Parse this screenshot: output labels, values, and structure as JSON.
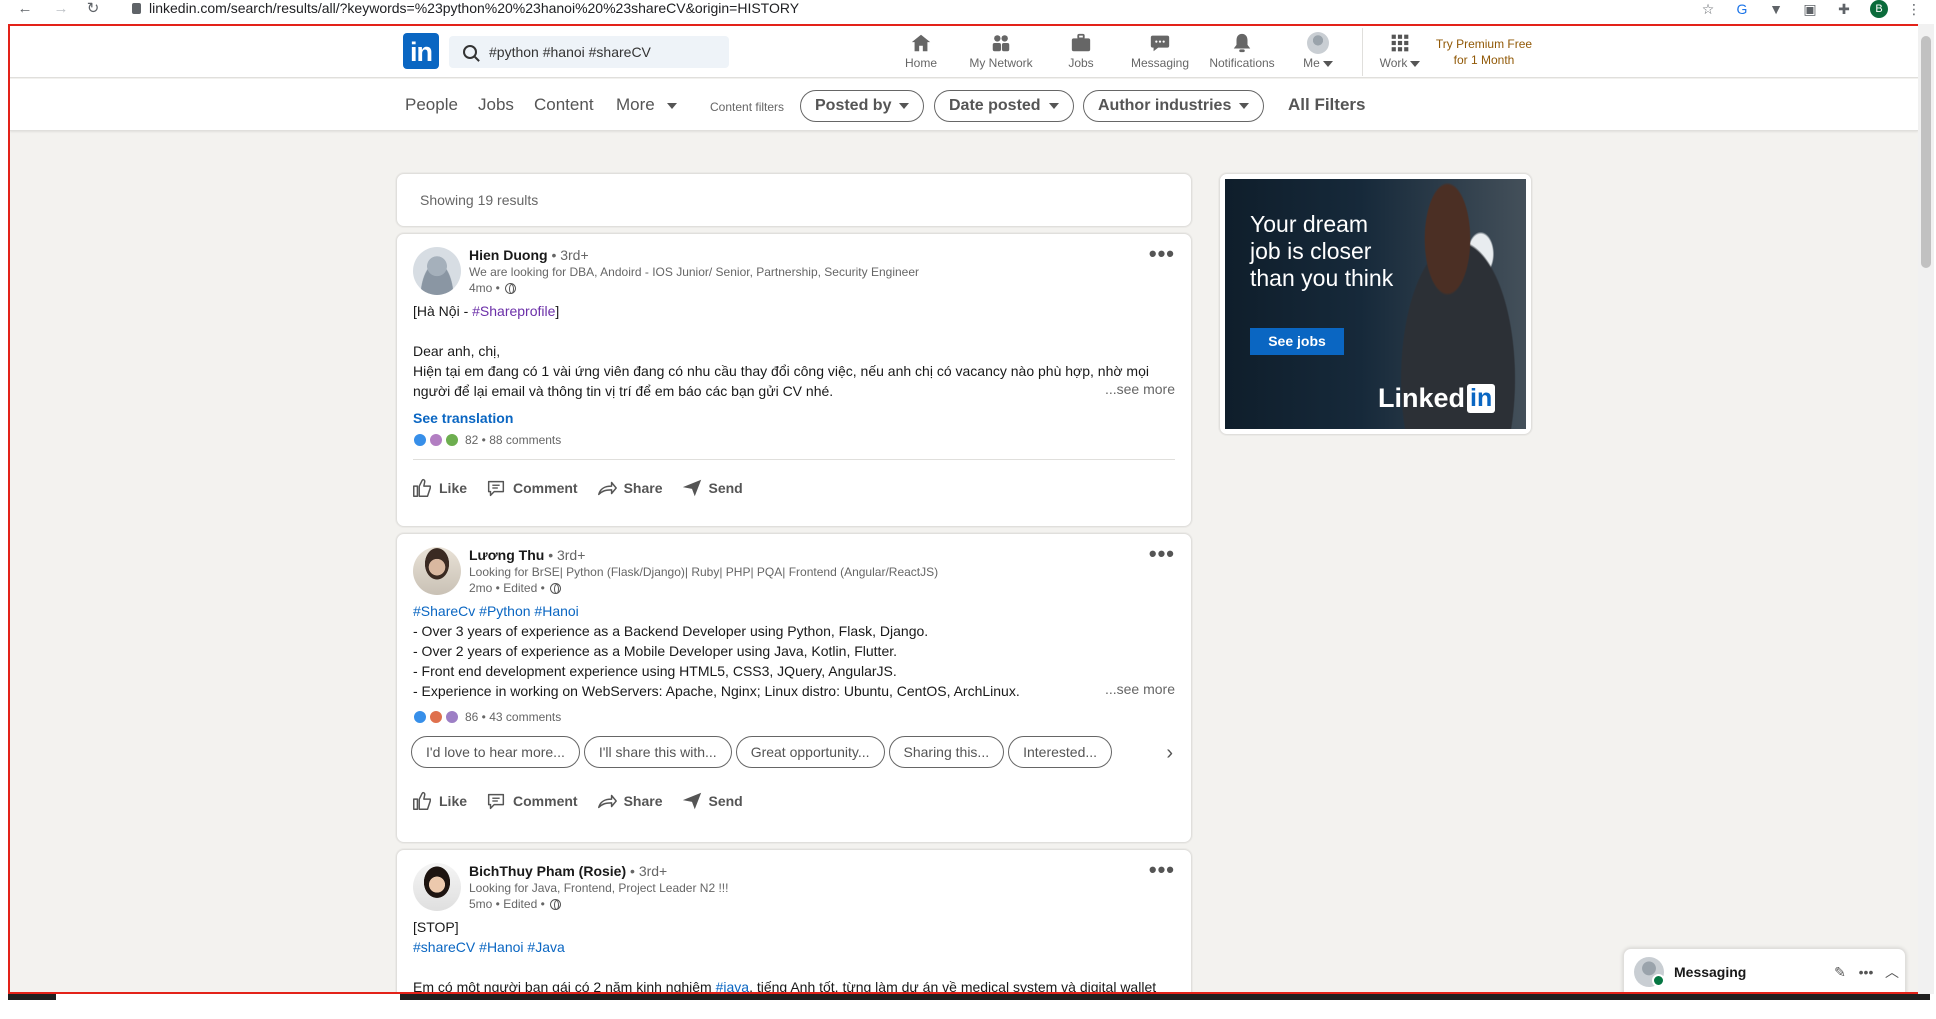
{
  "browser": {
    "url": "linkedin.com/search/results/all/?keywords=%23python%20%23hanoi%20%23shareCV&origin=HISTORY",
    "profile_initial": "B"
  },
  "nav": {
    "logo": "in",
    "search_value": "#python #hanoi #shareCV",
    "items": [
      {
        "label": "Home",
        "icon": "home-icon"
      },
      {
        "label": "My Network",
        "icon": "network-icon"
      },
      {
        "label": "Jobs",
        "icon": "briefcase-icon"
      },
      {
        "label": "Messaging",
        "icon": "chat-icon"
      },
      {
        "label": "Notifications",
        "icon": "bell-icon"
      },
      {
        "label": "Me",
        "icon": "avatar-icon"
      },
      {
        "label": "Work",
        "icon": "grid-icon"
      }
    ],
    "premium_line1": "Try Premium Free",
    "premium_line2": "for 1 Month"
  },
  "filters": {
    "tabs": [
      "People",
      "Jobs",
      "Content",
      "More"
    ],
    "content_filters_label": "Content filters",
    "pills": [
      "Posted by",
      "Date posted",
      "Author industries"
    ],
    "all_filters": "All Filters"
  },
  "results": {
    "label": "Showing 19 results"
  },
  "posts": [
    {
      "name": "Hien Duong",
      "degree": "• 3rd+",
      "headline": "We are looking for DBA, Andoird - IOS Junior/ Senior, Partnership, Security Engineer",
      "time": "4mo •",
      "lines": [
        "[Hà Nội - ",
        "#Shareprofile",
        "]"
      ],
      "body1": "Dear anh, chị,",
      "body2": "Hiện tại em đang có 1 vài ứng viên đang có nhu cầu thay đổi công việc, nếu anh chị có vacancy nào phù hợp, nhờ mọi",
      "body3": "người để lại email và thông tin vị trí để em báo các bạn gửi CV nhé.",
      "see_more": "...see more",
      "see_translation": "See translation",
      "reactions": "82 • 88 comments",
      "reaction_icons": [
        "like",
        "insight",
        "celebrate"
      ]
    },
    {
      "name": "Lương Thu",
      "degree": "• 3rd+",
      "headline": "Looking for BrSE| Python (Flask/Django)| Ruby| PHP| PQA| Frontend (Angular/ReactJS)",
      "time": "2mo • Edited •",
      "hashtags": [
        "#ShareCv",
        "#Python",
        "#Hanoi"
      ],
      "body": [
        "- Over 3 years of experience as a Backend Developer using Python, Flask, Django.",
        "- Over 2 years of experience as a Mobile Developer using Java, Kotlin, Flutter.",
        "- Front end development experience using HTML5, CSS3, JQuery, AngularJS.",
        "- Experience in working on WebServers: Apache, Nginx; Linux distro: Ubuntu, CentOS, ArchLinux."
      ],
      "see_more": "...see more",
      "reactions": "86 • 43 comments",
      "reaction_icons": [
        "like",
        "love",
        "support"
      ],
      "suggestions": [
        "I'd love to hear more...",
        "I'll share this with...",
        "Great opportunity...",
        "Sharing this...",
        "Interested..."
      ]
    },
    {
      "name": "BichThuy Pham (Rosie)",
      "degree": "• 3rd+",
      "headline": "Looking for Java, Frontend, Project Leader N2 !!!",
      "time": "5mo • Edited •",
      "line1": "[STOP]",
      "hashtags": [
        "#shareCV",
        "#Hanoi",
        "#Java"
      ],
      "partial_line_a": "Em có một người bạn gái có 2 năm kinh nghiệm ",
      "partial_tag": "#java",
      "partial_line_b": ", tiếng Anh tốt, từng làm dự án về medical system và digital wallet"
    }
  ],
  "actions": [
    "Like",
    "Comment",
    "Share",
    "Send"
  ],
  "ad": {
    "headline": "Your dream job is closer than you think",
    "button": "See jobs",
    "brand": "Linked",
    "brand_in": "in"
  },
  "messaging": {
    "label": "Messaging"
  },
  "colors": {
    "brand": "#0a66c2",
    "premium": "#915907",
    "frame": "#e32219"
  }
}
